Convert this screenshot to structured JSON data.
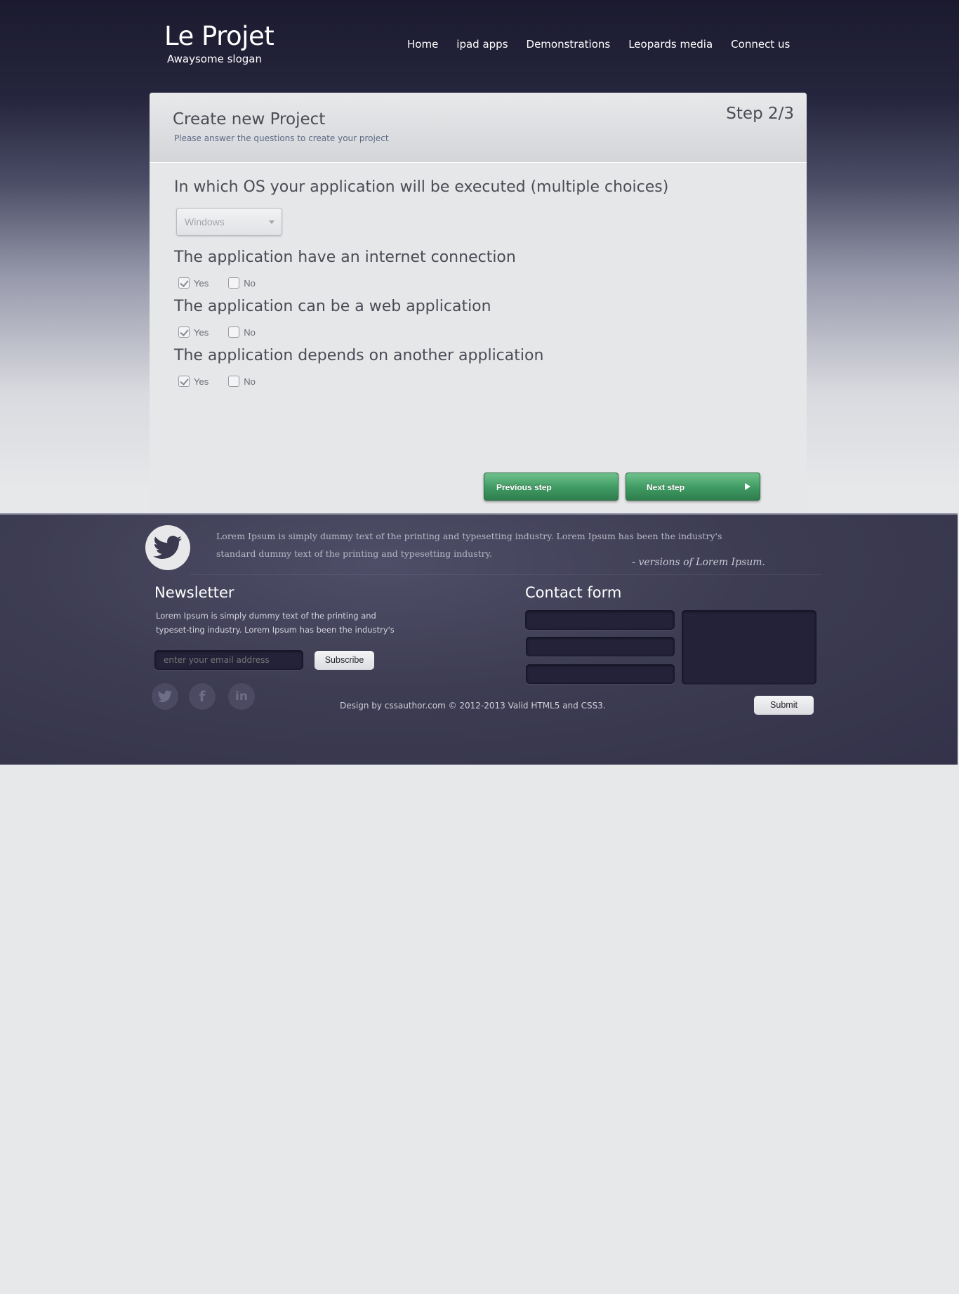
{
  "header": {
    "logo_title": "Le Projet",
    "logo_slogan": "Awaysome slogan",
    "nav": [
      "Home",
      "ipad apps",
      "Demonstrations",
      "Leopards media",
      "Connect us"
    ]
  },
  "panel": {
    "title": "Create new Project",
    "subtitle": "Please answer the questions to create your project",
    "step": "Step 2/3"
  },
  "questions": [
    {
      "text": "In which OS your application will be executed (multiple choices)",
      "type": "select",
      "selected": "Windows"
    },
    {
      "text": "The application have an internet connection",
      "options": [
        {
          "label": "Yes",
          "checked": true
        },
        {
          "label": "No",
          "checked": false
        }
      ]
    },
    {
      "text": "The application can be a web application",
      "options": [
        {
          "label": "Yes",
          "checked": true
        },
        {
          "label": "No",
          "checked": false
        }
      ]
    },
    {
      "text": "The application depends on another application",
      "options": [
        {
          "label": "Yes",
          "checked": true
        },
        {
          "label": "No",
          "checked": false
        }
      ]
    }
  ],
  "buttons": {
    "previous": "Previous step",
    "next": "Next step"
  },
  "footer": {
    "tweet_text": "Lorem Ipsum is simply dummy text of the printing and typesetting industry. Lorem Ipsum has been the industry's standard dummy text  of the printing and typesetting industry.",
    "tweet_source": "- versions of Lorem Ipsum.",
    "newsletter": {
      "title": "Newsletter",
      "text": "Lorem Ipsum is simply dummy text of the printing and typeset-ting industry. Lorem Ipsum has been the industry's",
      "email_placeholder": "enter your email address",
      "subscribe_label": "Subscribe"
    },
    "contact": {
      "title": "Contact form",
      "submit_label": "Submit"
    },
    "credits": "Design by cssauthor.com © 2012-2013  Valid HTML5 and CSS3.",
    "social_icons": [
      "twitter-icon",
      "facebook-icon",
      "linkedin-icon"
    ]
  },
  "colors": {
    "accent_green": "#3f9a62",
    "header_dark": "#1b1a2f",
    "footer_bg": "#3d3c52"
  }
}
